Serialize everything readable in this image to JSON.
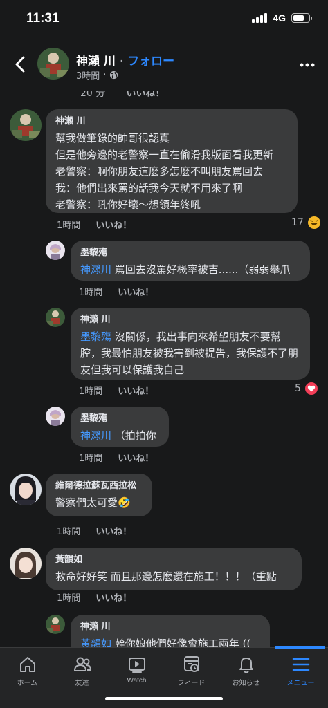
{
  "status": {
    "time": "11:31",
    "network": "4G"
  },
  "header": {
    "name": "神瀨 川",
    "separator": "·",
    "follow": "フォロー",
    "time": "3時間",
    "dot": "·"
  },
  "cut_row": {
    "time": "20 分",
    "like": "いいね！"
  },
  "comments": [
    {
      "author": "神瀨 川",
      "lines": [
        "幫我做筆錄的帥哥很認真",
        "但是他旁邊的老警察一直在偷滑我版面看我更新",
        "老警察：啊你朋友這麼多怎麼不叫朋友罵回去",
        "我：他們出來罵的話我今天就不用來了啊",
        "老警察：吼你好壞～想領年終吼"
      ],
      "time": "1時間",
      "like": "いいね！",
      "reaction_count": "17",
      "reaction_icon": "haha-icon"
    },
    {
      "author": "墨黎殤",
      "mention": "神瀨川",
      "text": " 罵回去沒罵好概率被吉......（弱弱舉爪",
      "time": "1時間",
      "like": "いいね！"
    },
    {
      "author": "神瀨 川",
      "mention": "墨黎殤",
      "text": " 沒關係，我出事向來希望朋友不要幫腔，我最怕朋友被我害到被提告，我保護不了朋友但我可以保護我自己",
      "time": "1時間",
      "like": "いいね！",
      "reaction_count": "5",
      "reaction_icon": "love-icon"
    },
    {
      "author": "墨黎殤",
      "mention": "神瀨川",
      "text": " （拍拍你",
      "time": "1時間",
      "like": "いいね！"
    },
    {
      "author": "維爾德拉蘇瓦西拉松",
      "text": "警察們太可愛🤣",
      "time": "1時間",
      "like": "いいね！"
    },
    {
      "author": "黃韻如",
      "text": "救命好好笑 而且那邊怎麼還在施工！！！（重點",
      "time": "1時間",
      "like": "いいね！"
    },
    {
      "author": "神瀨 川",
      "mention": "黃韻如",
      "text": " 幹你娘他們好像會施工兩年 ((",
      "time": "",
      "like": ""
    }
  ],
  "tabs": [
    {
      "label": "ホーム",
      "icon": "home-icon"
    },
    {
      "label": "友達",
      "icon": "friends-icon"
    },
    {
      "label": "Watch",
      "icon": "watch-icon"
    },
    {
      "label": "フィード",
      "icon": "feed-icon"
    },
    {
      "label": "お知らせ",
      "icon": "bell-icon"
    },
    {
      "label": "メニュー",
      "icon": "menu-icon"
    }
  ],
  "colors": {
    "accent": "#2d88ff",
    "bubble": "#3a3b3c",
    "background": "#18191a"
  }
}
